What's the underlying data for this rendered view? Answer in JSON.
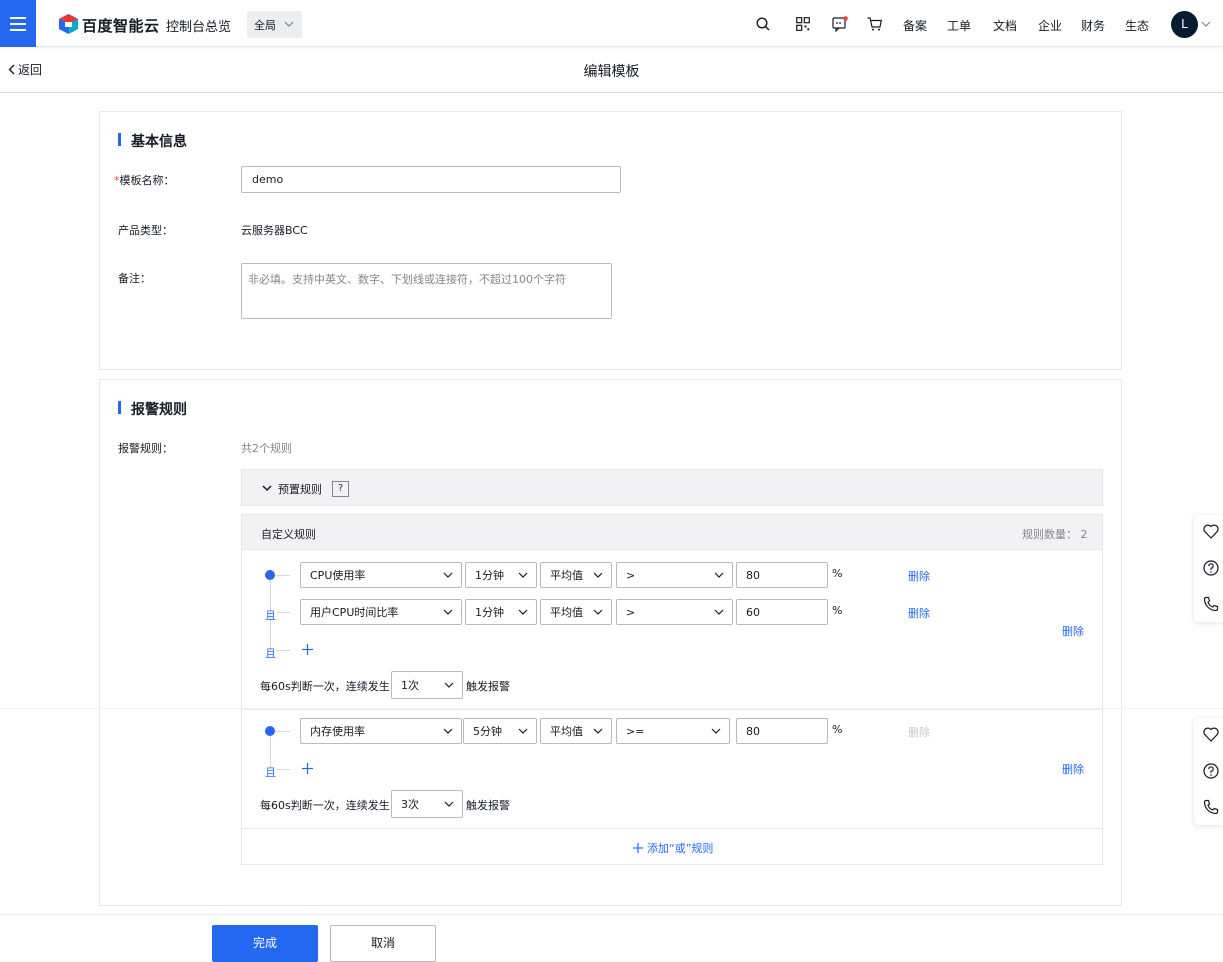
{
  "header": {
    "brand": "百度智能云",
    "console_link": "控制台总览",
    "region": "全局",
    "nav": [
      "备案",
      "工单",
      "文档",
      "企业",
      "财务",
      "生态"
    ],
    "avatar_letter": "L",
    "icons": [
      "search-icon",
      "qrcode-icon",
      "message-icon",
      "cart-icon"
    ],
    "accent_color": "#2468f2"
  },
  "subheader": {
    "back_label": "返回",
    "title": "编辑模板"
  },
  "basic_info": {
    "title": "基本信息",
    "name_label": "模板名称：",
    "name_required_mark": "*",
    "name_value": "demo",
    "product_label": "产品类型：",
    "product_value": "云服务器BCC",
    "note_label": "备注：",
    "note_placeholder": "非必填。支持中英文、数字、下划线或连接符，不超过100个字符"
  },
  "alarm_rules": {
    "title": "报警规则",
    "rules_label": "报警规则：",
    "rules_count_text": "共2个规则",
    "preset_label": "预置规则",
    "preset_help": "?",
    "custom_label": "自定义规则",
    "custom_count_text": "规则数量：  2",
    "and_label": "且",
    "delete_label": "删除",
    "percent": "%",
    "judge_prefix": "每60s判断一次，连续发生",
    "judge_suffix": "触发报警",
    "add_or_rule": "添加“或”规则",
    "group1": {
      "conditions": [
        {
          "metric": "CPU使用率",
          "period": "1分钟",
          "stat": "平均值",
          "op": ">",
          "value": "80"
        },
        {
          "metric": "用户CPU时间比率",
          "period": "1分钟",
          "stat": "平均值",
          "op": ">",
          "value": "60"
        }
      ],
      "times": "1次"
    },
    "group2": {
      "conditions": [
        {
          "metric": "内存使用率",
          "period": "5分钟",
          "stat": "平均值",
          "op": ">=",
          "value": "80"
        }
      ],
      "times": "3次"
    }
  },
  "footer": {
    "confirm": "完成",
    "cancel": "取消"
  }
}
